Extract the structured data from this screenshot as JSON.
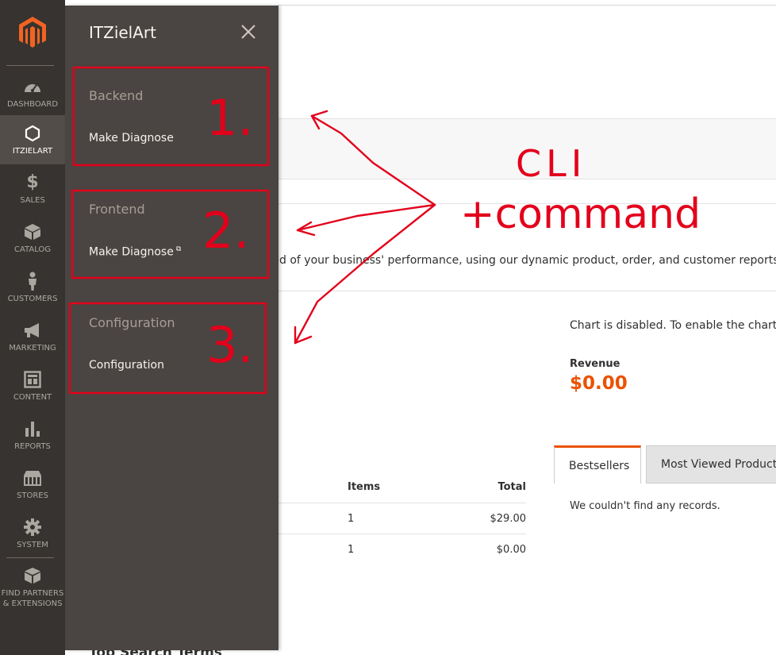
{
  "app": {
    "colors": {
      "nav_bg": "#373330",
      "nav_active_bg": "#524d49",
      "flyout_bg": "#4a4542",
      "accent": "#eb5202",
      "annotation": "#e3001b"
    }
  },
  "nav": {
    "logo_icon": "magento-logo-icon",
    "items": [
      {
        "label": "DASHBOARD",
        "icon": "dashboard-icon"
      },
      {
        "label": "ITZIELART",
        "icon": "hexagon-icon"
      },
      {
        "label": "SALES",
        "icon": "dollar-icon"
      },
      {
        "label": "CATALOG",
        "icon": "box-icon"
      },
      {
        "label": "CUSTOMERS",
        "icon": "person-icon"
      },
      {
        "label": "MARKETING",
        "icon": "megaphone-icon"
      },
      {
        "label": "CONTENT",
        "icon": "layout-icon"
      },
      {
        "label": "REPORTS",
        "icon": "bar-chart-icon"
      },
      {
        "label": "STORES",
        "icon": "store-icon"
      },
      {
        "label": "SYSTEM",
        "icon": "gear-icon"
      },
      {
        "label": "FIND PARTNERS & EXTENSIONS",
        "icon": "blocks-icon"
      }
    ]
  },
  "flyout": {
    "title": "ITZielArt",
    "close_icon": "close-icon",
    "sections": [
      {
        "title": "Backend",
        "link": "Make Diagnose"
      },
      {
        "title": "Frontend",
        "link": "Make Diagnose",
        "external_icon": "external-link-icon"
      },
      {
        "title": "Configuration",
        "link": "Configuration"
      }
    ]
  },
  "dashboard": {
    "intro": "d of your business' performance, using our dynamic product, order, and customer reports tailore",
    "chart_message": "Chart is disabled. To enable the chart, cli",
    "revenue_label": "Revenue",
    "revenue_value": "$0.00",
    "tabs": [
      "Bestsellers",
      "Most Viewed Products"
    ],
    "no_records": "We couldn't find any records.",
    "orders": {
      "headers": {
        "items": "Items",
        "total": "Total"
      },
      "rows": [
        {
          "items": "1",
          "total": "$29.00"
        },
        {
          "items": "1",
          "total": "$0.00"
        }
      ]
    },
    "search_terms_title": "Top Search Terms"
  },
  "annotations": {
    "numbers": [
      "1.",
      "2.",
      "3."
    ],
    "text_line1": "CLI",
    "text_line2": "+command"
  }
}
